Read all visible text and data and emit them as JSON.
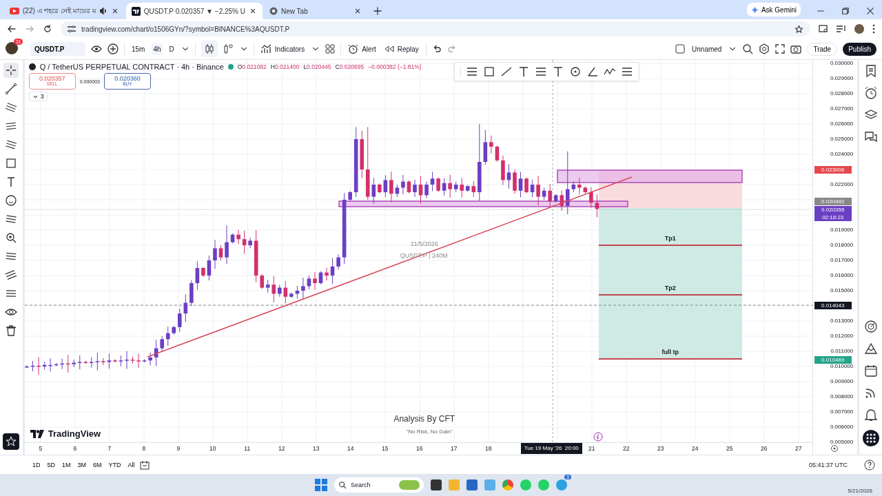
{
  "browser": {
    "tabs": [
      {
        "title": "(22) এ শহরে নেই মায়ের ম",
        "audio": true,
        "selected": false
      },
      {
        "title": "QUSDT.P 0.020357 ▼ −2.25% U",
        "audio": false,
        "selected": true
      },
      {
        "title": "New Tab",
        "audio": false,
        "selected": false
      }
    ],
    "ask_button": "Ask Gemini",
    "url": "tradingview.com/chart/o1506GYn/?symbol=BINANCE%3AQUSDT.P"
  },
  "toolbar": {
    "notification_count": "11",
    "symbol": "QUSDT.P",
    "intervals": [
      {
        "label": "15m",
        "selected": false
      },
      {
        "label": "4h",
        "selected": true
      },
      {
        "label": "D",
        "selected": false
      }
    ],
    "indicators": "Indicators",
    "alert": "Alert",
    "replay": "Replay",
    "layout_name": "Unnamed",
    "trade": "Trade",
    "publish": "Publish"
  },
  "chart_header": {
    "title": "Q / TetherUS PERPETUAL CONTRACT · 4h · Binance",
    "ohlc": [
      {
        "key": "O",
        "value": "0.021082"
      },
      {
        "key": "H",
        "value": "0.021400"
      },
      {
        "key": "L",
        "value": "0.020445"
      },
      {
        "key": "C",
        "value": "0.020695"
      }
    ],
    "change": "−0.000382 (−1.81%)",
    "sell_price": "0.020357",
    "sell_label": "SELL",
    "spread": "0.000003",
    "buy_price": "0.020360",
    "buy_label": "BUY",
    "indicator_count": "3"
  },
  "annotations": {
    "date": "21/5/2026",
    "symbol_note": "QUSDT.P | 240M",
    "targets": [
      {
        "label": "Tp1"
      },
      {
        "label": "Tp2"
      },
      {
        "label": "full tp"
      }
    ],
    "signature": "Analysis By CFT",
    "motto": "\"No Risk, No Gain\"",
    "brand": "TradingView"
  },
  "price_axis": {
    "ticks": [
      "0.030000",
      "0.029000",
      "0.028000",
      "0.027000",
      "0.026000",
      "0.025000",
      "0.024000",
      "0.022000",
      "0.019000",
      "0.018000",
      "0.017000",
      "0.016000",
      "0.015000",
      "0.013000",
      "0.012000",
      "0.011000",
      "0.010000",
      "0.009000",
      "0.008000",
      "0.007000",
      "0.006000",
      "0.005000"
    ],
    "badges": [
      {
        "text": "0.023006",
        "color": "#e5484d"
      },
      {
        "text": "0.020492",
        "color": "#888888"
      },
      {
        "text": "0.020355",
        "sub": "02:18:23",
        "color": "#6b3fc4"
      },
      {
        "text": "0.014043",
        "color": "#131722"
      },
      {
        "text": "0.010469",
        "color": "#22a38a"
      }
    ]
  },
  "time_axis": {
    "days": [
      "5",
      "6",
      "7",
      "8",
      "9",
      "10",
      "11",
      "12",
      "13",
      "14",
      "15",
      "16",
      "17",
      "18",
      "21",
      "22",
      "23",
      "24",
      "25",
      "26",
      "27"
    ],
    "crosshair_date": "Tue 19 May '26",
    "crosshair_time": "20:00"
  },
  "bottom_bar": {
    "ranges": [
      "1D",
      "5D",
      "1M",
      "3M",
      "6M",
      "YTD",
      "All"
    ],
    "clock": "05:41:37 UTC"
  },
  "taskbar": {
    "search": "Search",
    "telegram_badge": "3",
    "date": "5/21/2026"
  }
}
